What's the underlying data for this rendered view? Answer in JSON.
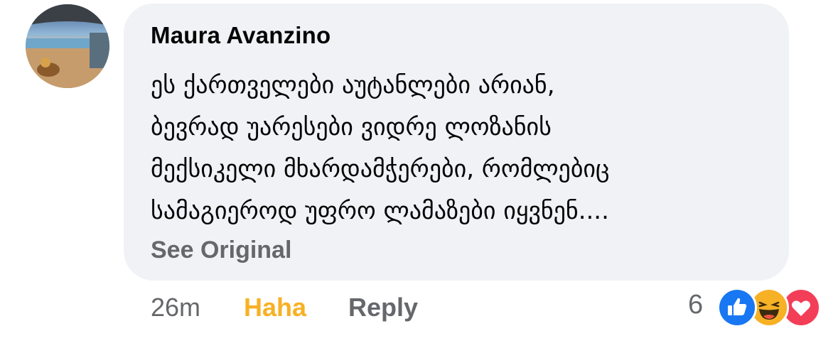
{
  "comment": {
    "author": "Maura Avanzino",
    "text_lines": [
      "ეს ქართველები აუტანლები არიან,",
      "ბევრად უარესები ვიდრე ლოზანის",
      "მექსიკელი მხარდამჭერები, რომლებიც",
      "სამაგიეროდ უფრო ლამაზები იყვნენ...."
    ],
    "see_original_label": "See Original",
    "timestamp": "26m",
    "current_reaction_label": "Haha",
    "reply_label": "Reply",
    "reaction_count": "6",
    "reaction_icons": [
      "like-icon",
      "haha-icon",
      "love-icon"
    ]
  },
  "colors": {
    "bubble_bg": "#f0f2f5",
    "text": "#050505",
    "secondary": "#65676b",
    "haha_active": "#f7b125",
    "like_blue": "#1877f2",
    "love_red": "#f33e58"
  }
}
